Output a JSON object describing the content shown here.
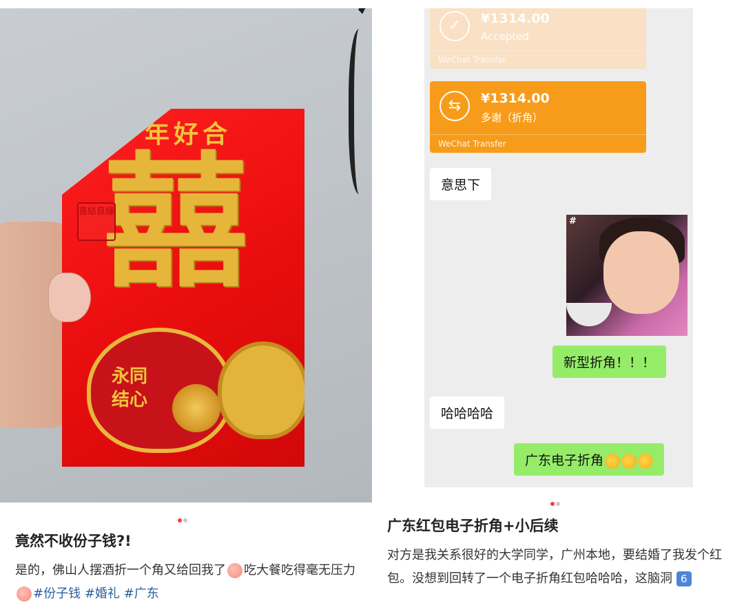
{
  "left_post": {
    "envelope_text": "年好合",
    "envelope_xi": "囍",
    "seal_text": "喜結良緣",
    "heart_text_line1": "永同",
    "heart_text_line2": "结心",
    "title": "竟然不收份子钱?!",
    "body_part1": "是的，佛山人摆酒折一个角又给回我了",
    "body_part2": "吃大餐吃得毫无压力",
    "hashtags": [
      "#份子钱",
      "#婚礼",
      "#广东"
    ]
  },
  "chat": {
    "transfer_accepted": {
      "amount": "¥1314.00",
      "status": "Accepted",
      "footer": "WeChat Transfer",
      "icon": "check-icon"
    },
    "transfer_sent": {
      "amount": "¥1314.00",
      "note": "多谢（折角）",
      "footer": "WeChat Transfer",
      "icon": "transfer-arrows-icon"
    },
    "messages": [
      {
        "side": "in",
        "text": "意思下"
      },
      {
        "side": "out",
        "text": "新型折角！！！"
      },
      {
        "side": "in",
        "text": "哈哈哈哈"
      },
      {
        "side": "out",
        "text": "广东电子折角"
      }
    ],
    "sticker_hash": "#"
  },
  "right_post": {
    "title": "广东红包电子折角+小后续",
    "body": "对方是我关系很好的大学同学，广州本地，要结婚了我发个红包。没想到回转了一个电子折角红包哈哈哈，这脑洞",
    "keycap": "6"
  },
  "colors": {
    "envelope_red": "#e80d0d",
    "gold": "#e5b63a",
    "transfer_orange": "#f79c1a",
    "bubble_green": "#95ec69",
    "hashtag_blue": "#2a5e9e",
    "dot_active": "#ff3b3b"
  }
}
